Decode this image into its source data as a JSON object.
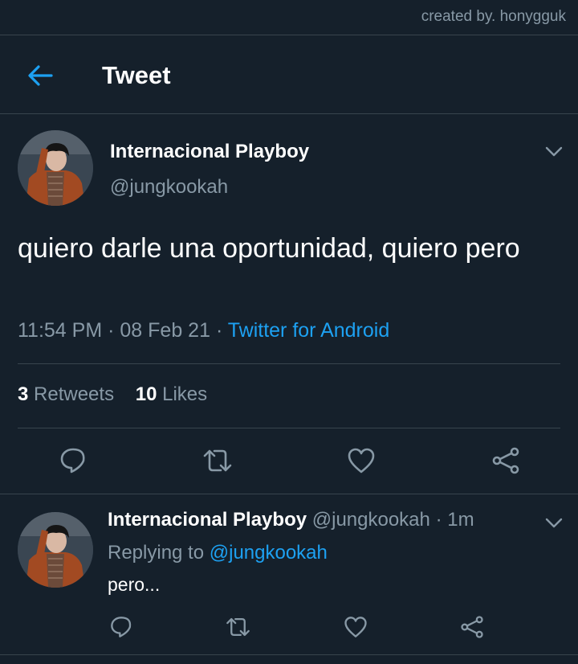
{
  "credit": "created by. honygguk",
  "header": {
    "title": "Tweet",
    "back_icon": "back-arrow-icon"
  },
  "colors": {
    "background": "#15202b",
    "accent": "#1da1f2",
    "muted": "#8899a6",
    "divider": "#38444d"
  },
  "tweet": {
    "name": "Internacional Playboy",
    "handle": "@jungkookah",
    "text": "quiero darle una oportunidad, quiero pero",
    "time": "11:54 PM",
    "sep1": "·",
    "date": "08 Feb 21",
    "sep2": "·",
    "source": "Twitter for Android",
    "retweets_count": "3",
    "retweets_label": "Retweets",
    "likes_count": "10",
    "likes_label": "Likes"
  },
  "reply": {
    "name": "Internacional Playboy",
    "handle": "@jungkookah",
    "dot": "·",
    "age": "1m",
    "replying_prefix": "Replying to",
    "replying_to": "@jungkookah",
    "text": "pero..."
  },
  "icons": {
    "reply": "reply-icon",
    "retweet": "retweet-icon",
    "like": "heart-icon",
    "share": "share-icon",
    "more": "chevron-down-icon"
  }
}
